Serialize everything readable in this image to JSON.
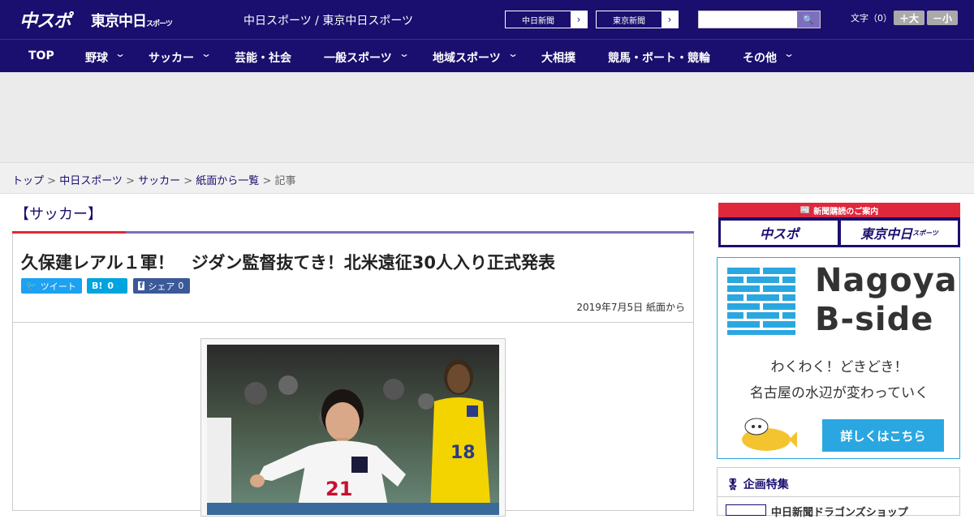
{
  "header": {
    "logo_text": "中スポ",
    "logo2_text": "東京中日",
    "logo2_small": "スポーツ",
    "site_title": "中日スポーツ / 東京中日スポーツ",
    "links": [
      {
        "label": "中日新聞"
      },
      {
        "label": "東京新聞"
      }
    ],
    "search_placeholder": "",
    "search_button": "🔍",
    "font_size_label": "文字（0）",
    "font_up": "＋大",
    "font_down": "－小"
  },
  "nav": {
    "items": [
      {
        "label": "TOP",
        "dropdown": false
      },
      {
        "label": "野球",
        "dropdown": true
      },
      {
        "label": "サッカー",
        "dropdown": true
      },
      {
        "label": "芸能・社会",
        "dropdown": false
      },
      {
        "label": "一般スポーツ",
        "dropdown": true
      },
      {
        "label": "地域スポーツ",
        "dropdown": true
      },
      {
        "label": "大相撲",
        "dropdown": false
      },
      {
        "label": "競馬・ボート・競輪",
        "dropdown": false
      },
      {
        "label": "その他",
        "dropdown": true
      }
    ]
  },
  "breadcrumb": {
    "items": [
      "トップ",
      "中日スポーツ",
      "サッカー",
      "紙面から一覧"
    ],
    "current": "記事",
    "separator": " > "
  },
  "article": {
    "category": "【サッカー】",
    "headline": "久保建レアル１軍！　ジダン監督抜てき！北米遠征30人入り正式発表",
    "share": {
      "tweet_label": "ツイート",
      "hatena_label": "B!",
      "hatena_count": "0",
      "facebook_label": "シェア",
      "facebook_count": "0"
    },
    "date": "2019年7月5日 紙面から",
    "photo_jersey_number": "21"
  },
  "sidebar": {
    "subscribe_header": "新聞購読のご案内",
    "subscribe_btn1": "中スポ",
    "subscribe_btn2": "東京中日",
    "subscribe_btn2_small": "スポーツ",
    "bside_title1": "Nagoya",
    "bside_title2": "B-side",
    "bside_line1": "わくわく！どきどき！",
    "bside_line2": "名古屋の水辺が変わっていく",
    "bside_cta": "詳しくはこちら",
    "feature_heading": "企画特集",
    "feature_item": "中日新聞ドラゴンズショップ"
  },
  "colors": {
    "brand": "#1a0f6e",
    "accent_red": "#e0283c",
    "accent_purple": "#7d6fc0",
    "bside_blue": "#2aa7e0",
    "twitter": "#1da1f2",
    "hatena": "#00a4de",
    "facebook": "#3b5998"
  }
}
